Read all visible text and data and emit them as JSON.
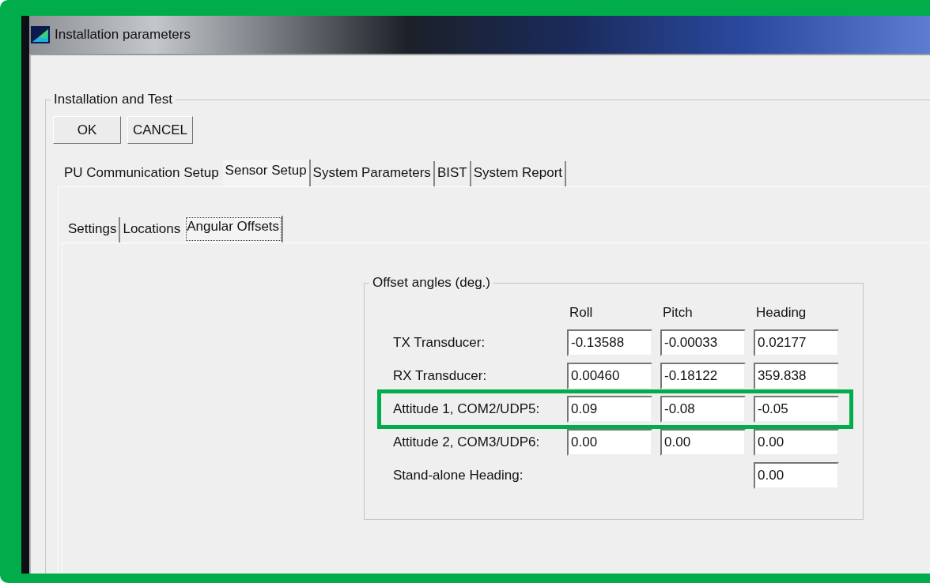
{
  "window": {
    "title": "Installation parameters"
  },
  "group": {
    "title": "Installation and Test"
  },
  "buttons": [
    "OK",
    "CANCEL"
  ],
  "tabs": [
    {
      "label": "PU Communication Setup",
      "selected": false
    },
    {
      "label": "Sensor Setup",
      "selected": true
    },
    {
      "label": "System Parameters",
      "selected": false
    },
    {
      "label": "BIST",
      "selected": false
    },
    {
      "label": "System Report",
      "selected": false
    }
  ],
  "subtabs": [
    {
      "label": "Settings",
      "selected": false
    },
    {
      "label": "Locations",
      "selected": false
    },
    {
      "label": "Angular Offsets",
      "selected": true
    }
  ],
  "offsets": {
    "title": "Offset angles (deg.)",
    "columns": [
      "Roll",
      "Pitch",
      "Heading"
    ],
    "rows": [
      {
        "kind": "full",
        "label": "TX Transducer:",
        "values": [
          "-0.13588",
          "-0.00033",
          "0.02177"
        ],
        "highlighted": false
      },
      {
        "kind": "full",
        "label": "RX Transducer:",
        "values": [
          "0.00460",
          "-0.18122",
          "359.838"
        ],
        "highlighted": false
      },
      {
        "kind": "full",
        "label": "Attitude 1, COM2/UDP5:",
        "values": [
          "0.09",
          "-0.08",
          "-0.05"
        ],
        "highlighted": true
      },
      {
        "kind": "full",
        "label": "Attitude 2, COM3/UDP6:",
        "values": [
          "0.00",
          "0.00",
          "0.00"
        ],
        "highlighted": false
      },
      {
        "kind": "heading_only",
        "label": "Stand-alone Heading:",
        "values": [
          "0.00"
        ],
        "highlighted": false
      }
    ]
  }
}
